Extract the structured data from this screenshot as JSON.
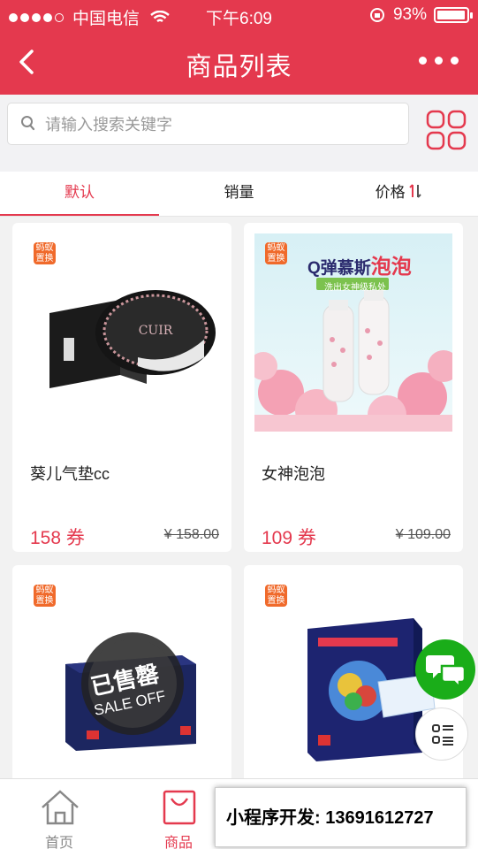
{
  "status": {
    "carrier": "中国电信",
    "time": "下午6:09",
    "battery_pct": "93%"
  },
  "nav": {
    "title": "商品列表"
  },
  "search": {
    "placeholder": "请输入搜索关键字"
  },
  "sort_tabs": [
    {
      "label": "默认"
    },
    {
      "label": "销量"
    },
    {
      "label": "价格"
    }
  ],
  "products": [
    {
      "badge": "蚂蚁置换",
      "name": "葵儿气垫cc",
      "price": "158 券",
      "original": "¥ 158.00"
    },
    {
      "badge": "蚂蚁置换",
      "name": "女神泡泡",
      "price": "109 券",
      "original": "¥ 109.00",
      "image_text": "Q弹慕斯",
      "image_text_accent": "泡泡",
      "image_subtext": "洗出女神级私处"
    },
    {
      "badge": "蚂蚁置换",
      "sold_out_text": "已售罄",
      "sold_out_en": "SALE OFF"
    },
    {
      "badge": "蚂蚁置换"
    }
  ],
  "tabbar": [
    {
      "label": "首页"
    },
    {
      "label": "商品"
    }
  ],
  "banner": {
    "text": "小程序开发: 13691612727"
  },
  "colors": {
    "accent": "#e4394e",
    "chat_green": "#1aad19"
  }
}
